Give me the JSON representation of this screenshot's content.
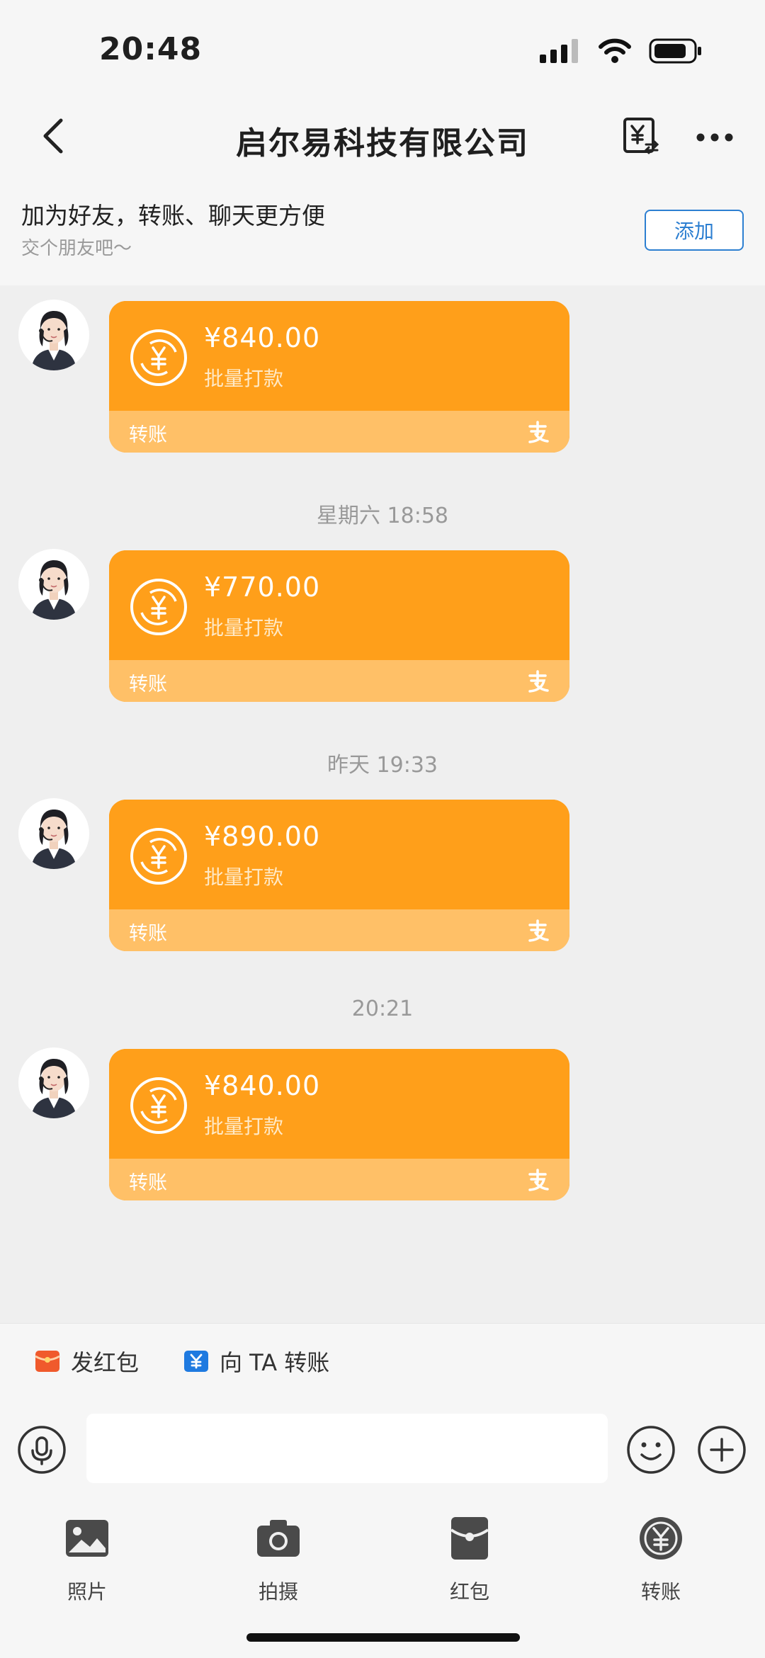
{
  "status_bar": {
    "time": "20:48"
  },
  "header": {
    "title": "启尔易科技有限公司"
  },
  "banner": {
    "title": "加为好友，转账、聊天更方便",
    "subtitle": "交个朋友吧～",
    "add_label": "添加"
  },
  "messages": [
    {
      "amount": "¥840.00",
      "note": "批量打款",
      "label": "转账"
    },
    {
      "timestamp": "星期六 18:58",
      "amount": "¥770.00",
      "note": "批量打款",
      "label": "转账"
    },
    {
      "timestamp": "昨天 19:33",
      "amount": "¥890.00",
      "note": "批量打款",
      "label": "转账"
    },
    {
      "timestamp": "20:21",
      "amount": "¥840.00",
      "note": "批量打款",
      "label": "转账"
    }
  ],
  "quick_actions": [
    {
      "label": "发红包",
      "icon": "red-packet-icon"
    },
    {
      "label": "向 TA 转账",
      "icon": "transfer-card-icon"
    }
  ],
  "input": {
    "placeholder": "",
    "value": ""
  },
  "tools": [
    {
      "label": "照片",
      "icon": "photo-icon"
    },
    {
      "label": "拍摄",
      "icon": "camera-icon"
    },
    {
      "label": "红包",
      "icon": "red-packet-icon"
    },
    {
      "label": "转账",
      "icon": "transfer-icon"
    }
  ],
  "colors": {
    "bubble": "#ff9f1a",
    "bubble_footer": "#ffc067",
    "link_blue": "#2d7fd1",
    "background": "#efefef"
  }
}
